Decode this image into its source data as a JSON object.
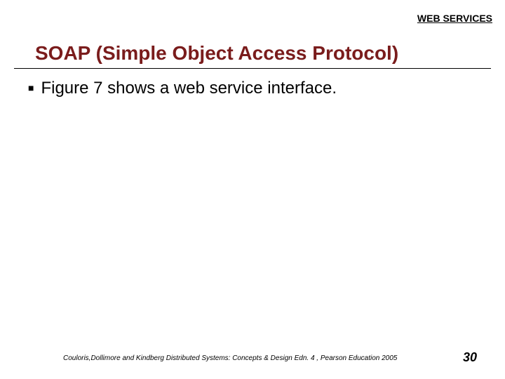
{
  "header": {
    "label": "WEB SERVICES"
  },
  "title": "SOAP (Simple Object Access Protocol)",
  "bullets": [
    "Figure 7 shows a web service interface."
  ],
  "footer": {
    "citation": "Couloris,Dollimore and Kindberg  Distributed Systems: Concepts & Design  Edn. 4 , Pearson Education 2005",
    "page_number": "30"
  }
}
